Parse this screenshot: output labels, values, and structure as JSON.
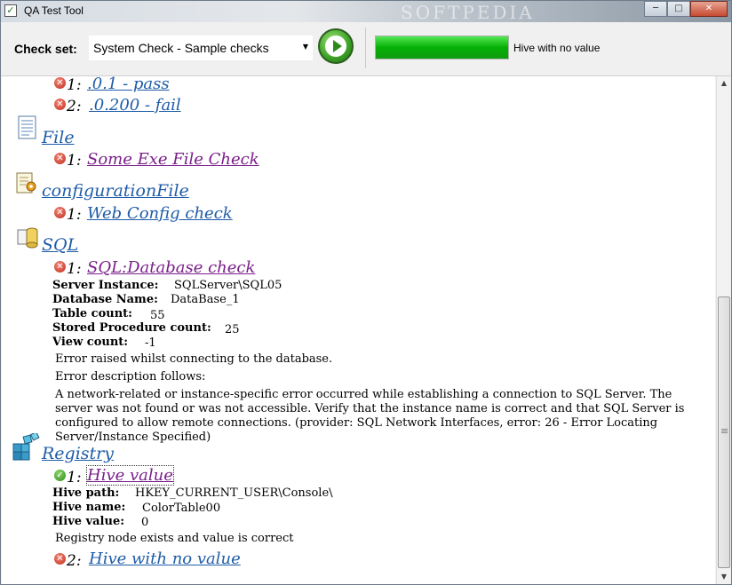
{
  "window": {
    "title": "QA Test Tool",
    "watermark": "SOFTPEDIA",
    "buttons": {
      "minimize": "─",
      "maximize": "□",
      "close": "✕"
    }
  },
  "toolbar": {
    "check_set_label": "Check set:",
    "check_set_value": "System Check - Sample checks",
    "combo_arrow": "▼",
    "progress_fraction": 1.0,
    "status_text": "Hive with no value"
  },
  "content": {
    "top_items": [
      {
        "num": "1:",
        "link": ".0.1 - pass",
        "status": "fail"
      },
      {
        "num": "2:",
        "link": ".0.200 - fail",
        "status": "fail"
      }
    ],
    "categories": {
      "file": {
        "name": "File",
        "icon": "document-icon",
        "checks": [
          {
            "num": "1:",
            "link": "Some Exe File Check",
            "status": "fail"
          }
        ]
      },
      "config": {
        "name": "configurationFile",
        "icon": "config-file-icon",
        "checks": [
          {
            "num": "1:",
            "link": "Web Config check",
            "status": "fail"
          }
        ]
      },
      "sql": {
        "name": "SQL",
        "icon": "database-icon",
        "checks": [
          {
            "num": "1:",
            "link": "SQL:Database check",
            "status": "fail",
            "details": [
              {
                "label": "Server Instance:",
                "value": "SQLServer\\SQL05"
              },
              {
                "label": "Database Name:",
                "value": "DataBase_1"
              },
              {
                "label": "Table count:",
                "value": "55"
              },
              {
                "label": "Stored Procedure count:",
                "value": "25"
              },
              {
                "label": "View count:",
                "value": "-1"
              }
            ],
            "messages": [
              "Error raised whilst connecting to the database.",
              "Error description follows:",
              "A network-related or instance-specific error occurred while establishing a connection to SQL Server. The server was not found or was not accessible. Verify that the instance name is correct and that SQL Server is configured to allow remote connections. (provider: SQL Network Interfaces, error: 26 - Error Locating Server/Instance Specified)"
            ]
          }
        ]
      },
      "registry": {
        "name": "Registry",
        "icon": "registry-icon",
        "checks": [
          {
            "num": "1:",
            "link": "Hive value",
            "status": "pass",
            "details": [
              {
                "label": "Hive path:",
                "value": "HKEY_CURRENT_USER\\Console\\"
              },
              {
                "label": "Hive name:",
                "value": "ColorTable00"
              },
              {
                "label": "Hive value:",
                "value": "0"
              }
            ],
            "messages": [
              "Registry node exists and value is correct"
            ]
          },
          {
            "num": "2:",
            "link": "Hive with no value",
            "status": "fail"
          }
        ]
      }
    },
    "status_symbols": {
      "fail": "✕",
      "pass": "✓"
    }
  },
  "scrollbar": {
    "up": "▲",
    "down": "▼"
  },
  "colors": {
    "link": "#1e5ca8",
    "visited_link": "#7a1f8a",
    "fail": "#c22a1a",
    "pass": "#2d8a1a",
    "progress": "#06b006"
  }
}
